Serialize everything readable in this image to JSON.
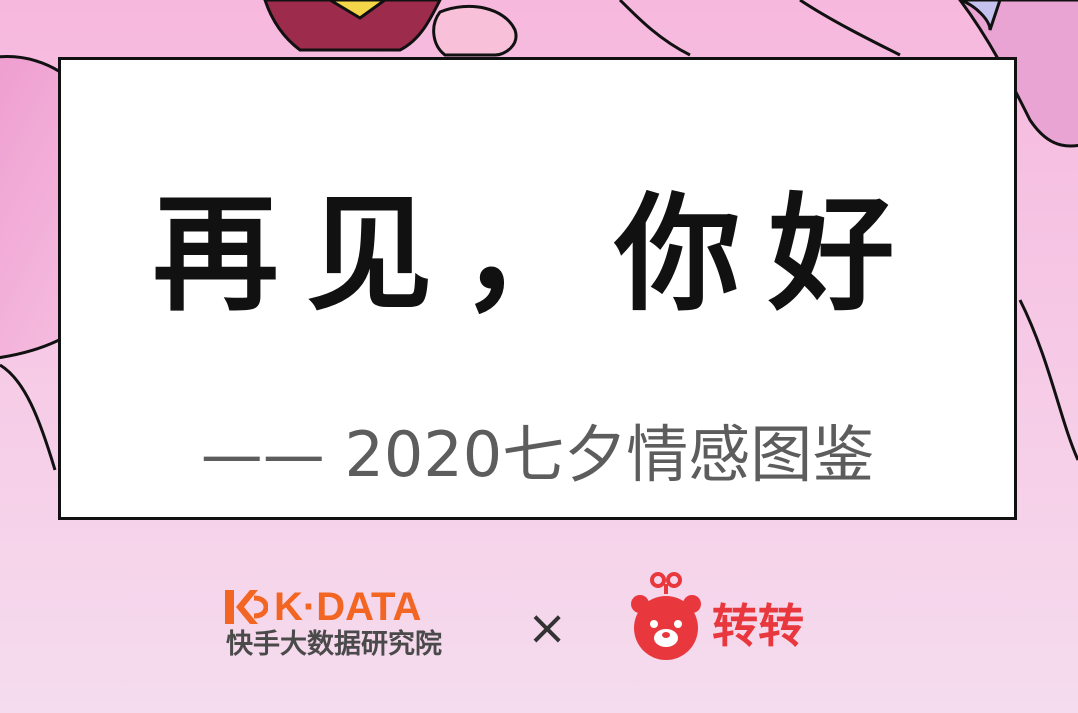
{
  "card": {
    "title": "再见，你好",
    "subtitle": "—— 2020七夕情感图鉴"
  },
  "brands": {
    "left_name": "K·DATA",
    "left_sub": "快手大数据研究院",
    "separator": "×",
    "right_name": "转转"
  },
  "icons": {
    "left_logo": "kdata-logo-icon",
    "right_logo": "zhuanzhuan-bear-icon"
  },
  "colors": {
    "background": "#f4c9e6",
    "kdata_orange": "#f26522",
    "zhuanzhuan_red": "#e8383d",
    "title": "#111111",
    "subtitle": "#5d5d5d"
  }
}
